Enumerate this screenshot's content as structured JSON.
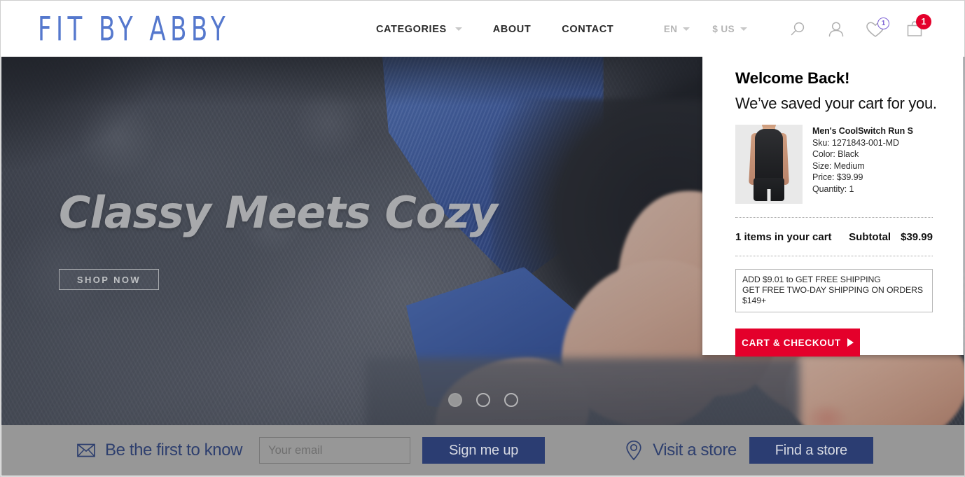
{
  "brand": {
    "logo": "FIT BY ABBY",
    "logo_color": "#5578cd"
  },
  "header": {
    "nav": [
      {
        "label": "CATEGORIES",
        "has_dropdown": true
      },
      {
        "label": "ABOUT",
        "has_dropdown": false
      },
      {
        "label": "CONTACT",
        "has_dropdown": false
      }
    ],
    "language": {
      "label": "EN"
    },
    "currency": {
      "label": "$ US"
    },
    "icons": [
      {
        "name": "search-icon"
      },
      {
        "name": "account-icon"
      },
      {
        "name": "wishlist-heart-icon",
        "badge": "1",
        "badge_color": "#7b5fd4"
      },
      {
        "name": "cart-bag-icon",
        "badge": "1",
        "badge_color": "#e4002b"
      }
    ]
  },
  "hero": {
    "title": "Classy Meets Cozy",
    "cta": "SHOP NOW",
    "carousel": {
      "total": 3,
      "active_index": 0
    }
  },
  "cart_panel": {
    "heading": "Welcome Back!",
    "subheading": "We’ve saved your cart for you.",
    "product": {
      "name": "Men's CoolSwitch Run S",
      "sku": "Sku: 1271843-001-MD",
      "color": "Color: Black",
      "size": "Size: Medium",
      "price": "Price: $39.99",
      "quantity": "Quantity: 1"
    },
    "items_count_label": "1 items in your cart",
    "subtotal_label": "Subtotal",
    "subtotal_value": "$39.99",
    "shipping_note_line1": "ADD $9.01 to GET FREE SHIPPING",
    "shipping_note_line2": "GET FREE TWO-DAY SHIPPING ON ORDERS",
    "shipping_note_line3": "$149+",
    "checkout_button": "CART & CHECKOUT",
    "accent_color": "#e4002b"
  },
  "footer": {
    "newsletter_label": "Be the first to know",
    "email_placeholder": "Your email",
    "email_value": "",
    "signup_button": "Sign me up",
    "store_label": "Visit a store",
    "find_store_button": "Find a store",
    "navy_color": "#2b3d72",
    "bar_color": "#979797"
  }
}
